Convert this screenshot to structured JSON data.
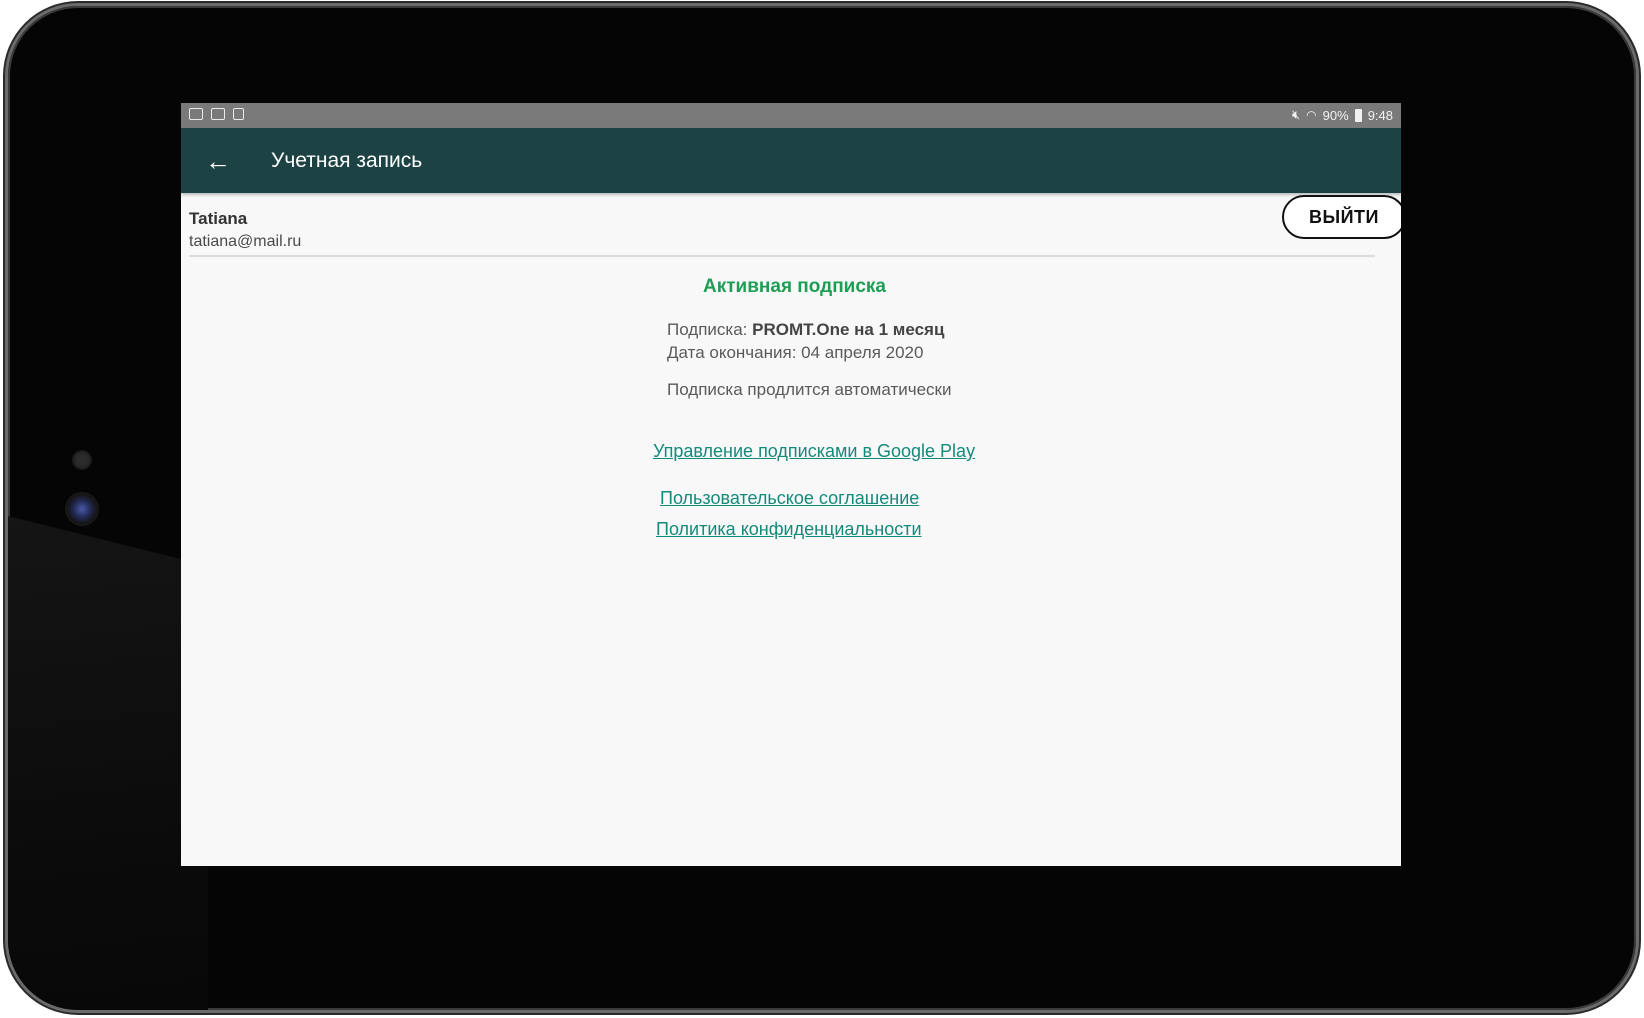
{
  "statusbar": {
    "left_icons": [
      "mail-icon",
      "image-icon",
      "file-settings-icon"
    ],
    "battery": "90%",
    "time": "9:48"
  },
  "toolbar": {
    "title": "Учетная запись"
  },
  "account": {
    "name": "Tatiana",
    "email": "tatiana@mail.ru",
    "logout_label": "ВЫЙТИ"
  },
  "subscription": {
    "status_title": "Активная подписка",
    "plan_label": "Подписка:",
    "plan_value": "PROMT.One на 1 месяц",
    "end_date": "Дата окончания: 04 апреля 2020",
    "auto_renew": "Подписка продлится автоматически"
  },
  "links": {
    "manage_google_play": "Управление подписками в Google Play",
    "user_agreement": "Пользовательское соглашение",
    "privacy_policy": "Политика конфиденциальности"
  },
  "colors": {
    "toolbar_bg": "#1d4244",
    "active_green": "#1e9e55",
    "link_teal": "#138a7a",
    "statusbar_bg": "#7a7a7a"
  }
}
